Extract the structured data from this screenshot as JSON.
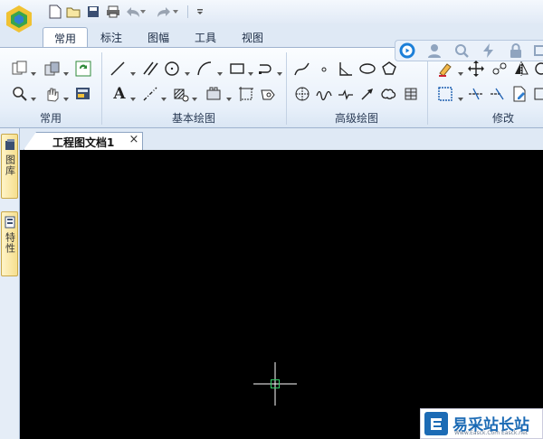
{
  "tabs": [
    "常用",
    "标注",
    "图幅",
    "工具",
    "视图"
  ],
  "active_tab": "常用",
  "groups": [
    {
      "label": "常用"
    },
    {
      "label": "基本绘图"
    },
    {
      "label": "高级绘图"
    },
    {
      "label": "修改"
    }
  ],
  "document": {
    "tab_label": "工程图文档1",
    "close_glyph": "×"
  },
  "side_tabs": [
    {
      "label": "图库"
    },
    {
      "label": "特性"
    }
  ],
  "watermark": {
    "text": "易采站长站",
    "sub": "Www.Easck.Com  Easck.net"
  },
  "icons": {
    "text_tool": "A"
  },
  "colors": {
    "accent": "#1c6bb5",
    "canvas": "#000000",
    "crosshair": "#ffffff",
    "pick_box": "#33cc66"
  }
}
